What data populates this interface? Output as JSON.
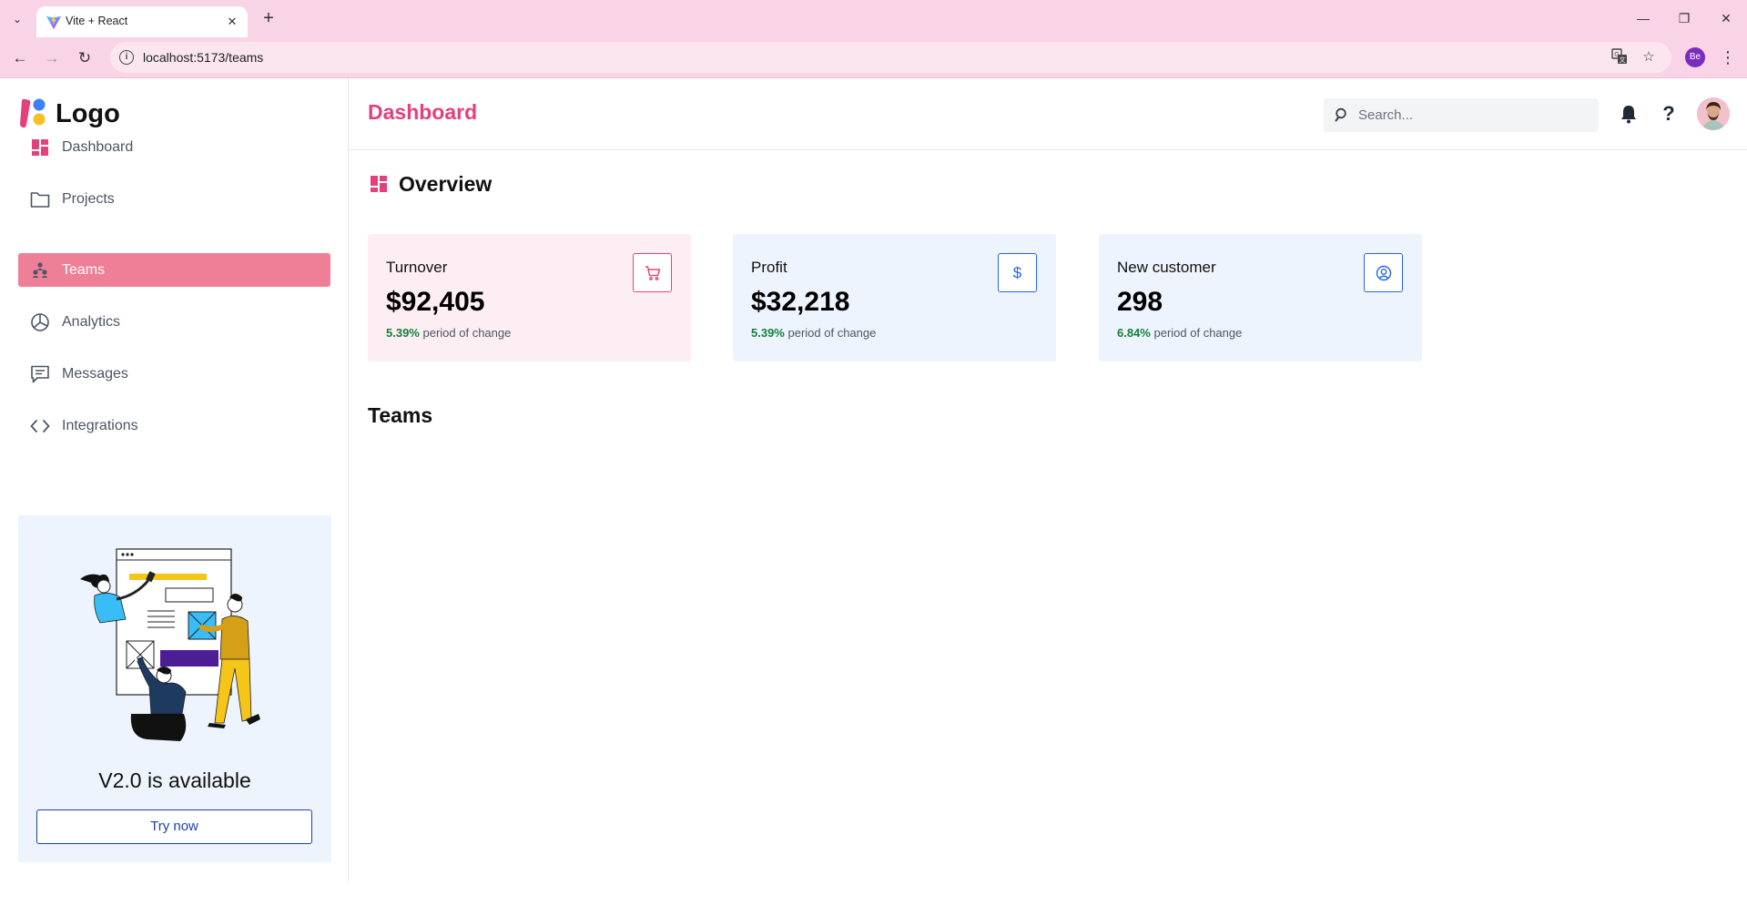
{
  "browser": {
    "tab_title": "Vite + React",
    "url": "localhost:5173/teams",
    "profile_initials": "Be"
  },
  "sidebar": {
    "logo_text": "Logo",
    "items": [
      {
        "label": "Dashboard",
        "icon": "dashboard-icon",
        "active": false
      },
      {
        "label": "Projects",
        "icon": "folder-icon",
        "active": false
      },
      {
        "label": "Teams",
        "icon": "teams-icon",
        "active": true
      },
      {
        "label": "Analytics",
        "icon": "pie-chart-icon",
        "active": false
      },
      {
        "label": "Messages",
        "icon": "message-icon",
        "active": false
      },
      {
        "label": "Integrations",
        "icon": "code-icon",
        "active": false
      }
    ],
    "promo": {
      "title": "V2.0 is available",
      "button_label": "Try now"
    }
  },
  "header": {
    "title": "Dashboard",
    "search_placeholder": "Search..."
  },
  "overview": {
    "title": "Overview",
    "cards": [
      {
        "label": "Turnover",
        "value": "$92,405",
        "change_pct": "5.39%",
        "change_text": "period of change",
        "icon": "cart-icon",
        "bg": "#fdeef3",
        "accent": "#e5407a"
      },
      {
        "label": "Profit",
        "value": "$32,218",
        "change_pct": "5.39%",
        "change_text": "period of change",
        "icon": "dollar-icon",
        "bg": "#eef4fd",
        "accent": "#2563eb"
      },
      {
        "label": "New customer",
        "value": "298",
        "change_pct": "6.84%",
        "change_text": "period of change",
        "icon": "user-circle-icon",
        "bg": "#eef4fd",
        "accent": "#2563eb"
      }
    ]
  },
  "teams": {
    "title": "Teams"
  },
  "colors": {
    "brand": "#e5407a",
    "active_nav": "#ef7f97",
    "positive": "#15803d"
  }
}
